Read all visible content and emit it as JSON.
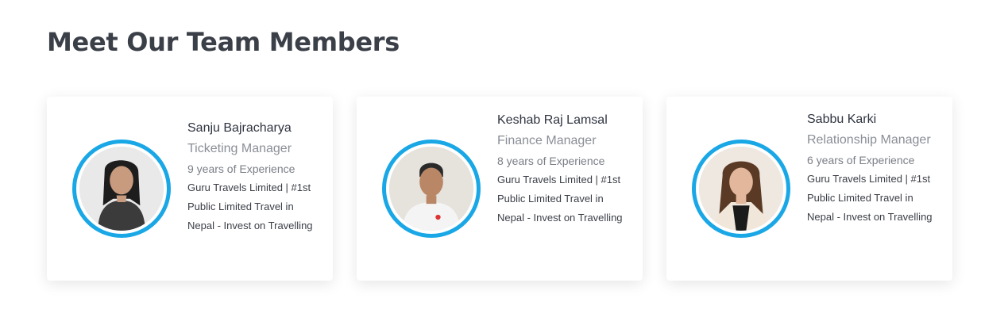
{
  "section": {
    "title": "Meet Our Team Members"
  },
  "members": [
    {
      "name": "Sanju Bajracharya",
      "role": "Ticketing Manager",
      "experience": "9 years of Experience",
      "description": "Guru Travels Limited | #1st Public Limited Travel in Nepal - Invest on Travelling"
    },
    {
      "name": "Keshab Raj Lamsal",
      "role": "Finance Manager",
      "experience": "8 years of Experience",
      "description": "Guru Travels Limited | #1st Public Limited Travel in Nepal - Invest on Travelling"
    },
    {
      "name": "Sabbu Karki",
      "role": "Relationship Manager",
      "experience": "6 years of Experience",
      "description": "Guru Travels Limited | #1st Public Limited Travel in Nepal - Invest on Travelling"
    }
  ],
  "colors": {
    "accent_ring": "#1aa7e6",
    "title": "#3a3f48"
  }
}
